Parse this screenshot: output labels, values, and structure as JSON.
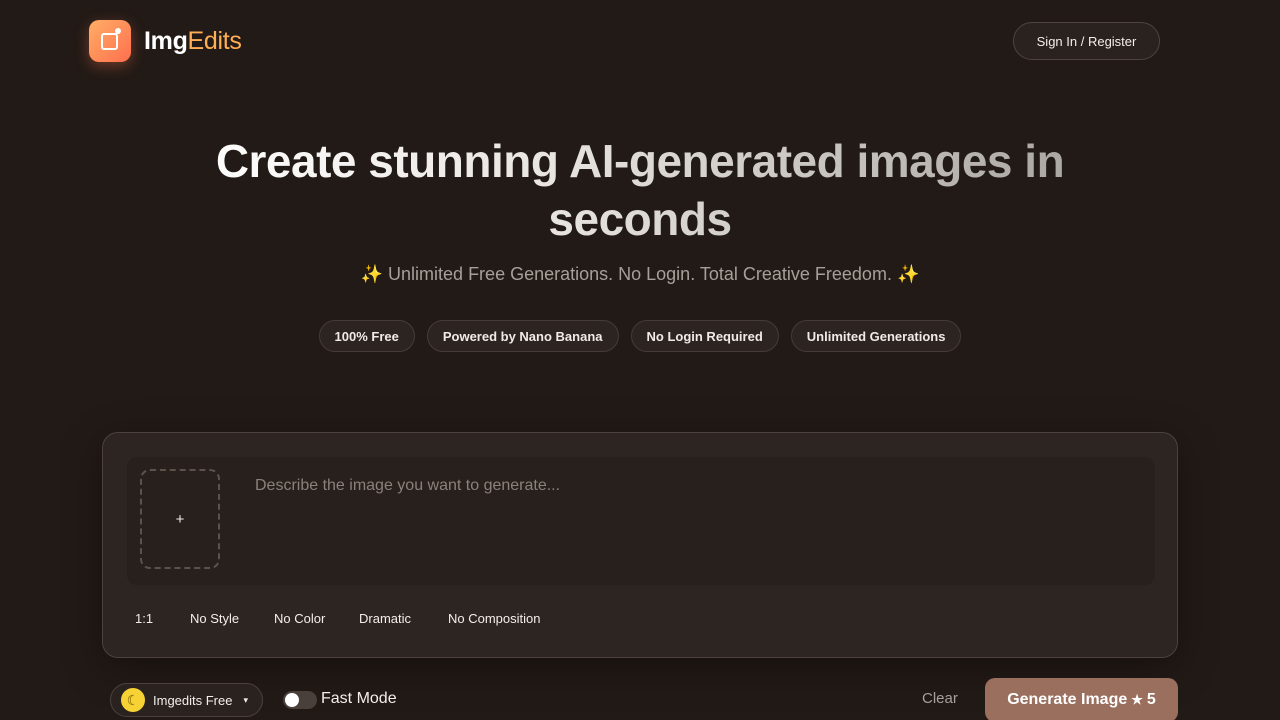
{
  "header": {
    "brand_part1": "Img",
    "brand_part2": "Edits",
    "signin_label": "Sign In / Register"
  },
  "hero": {
    "title": "Create stunning AI-generated images in seconds",
    "subtitle": "✨ Unlimited Free Generations. No Login. Total Creative Freedom. ✨",
    "badges": [
      "100% Free",
      "Powered by Nano Banana",
      "No Login Required",
      "Unlimited Generations"
    ]
  },
  "generator": {
    "upload_label": "+",
    "prompt_placeholder": "Describe the image you want to generate...",
    "prompt_value": "",
    "options": {
      "aspect_ratio": "1:1",
      "style": "No Style",
      "color": "No Color",
      "lighting": "Dramatic",
      "composition": "No Composition"
    }
  },
  "controls": {
    "model_label": "Imgedits Free",
    "model_caret": "▾",
    "model_icon": "moon-icon",
    "fast_mode_label": "Fast Mode",
    "fast_mode_on": false,
    "clear_label": "Clear",
    "generate_label": "Generate Image",
    "generate_star": "★",
    "generate_cost": "5"
  },
  "colors": {
    "background": "#221a16",
    "accent_orange": "#ffae55",
    "generate_button": "#9a6f5e"
  }
}
